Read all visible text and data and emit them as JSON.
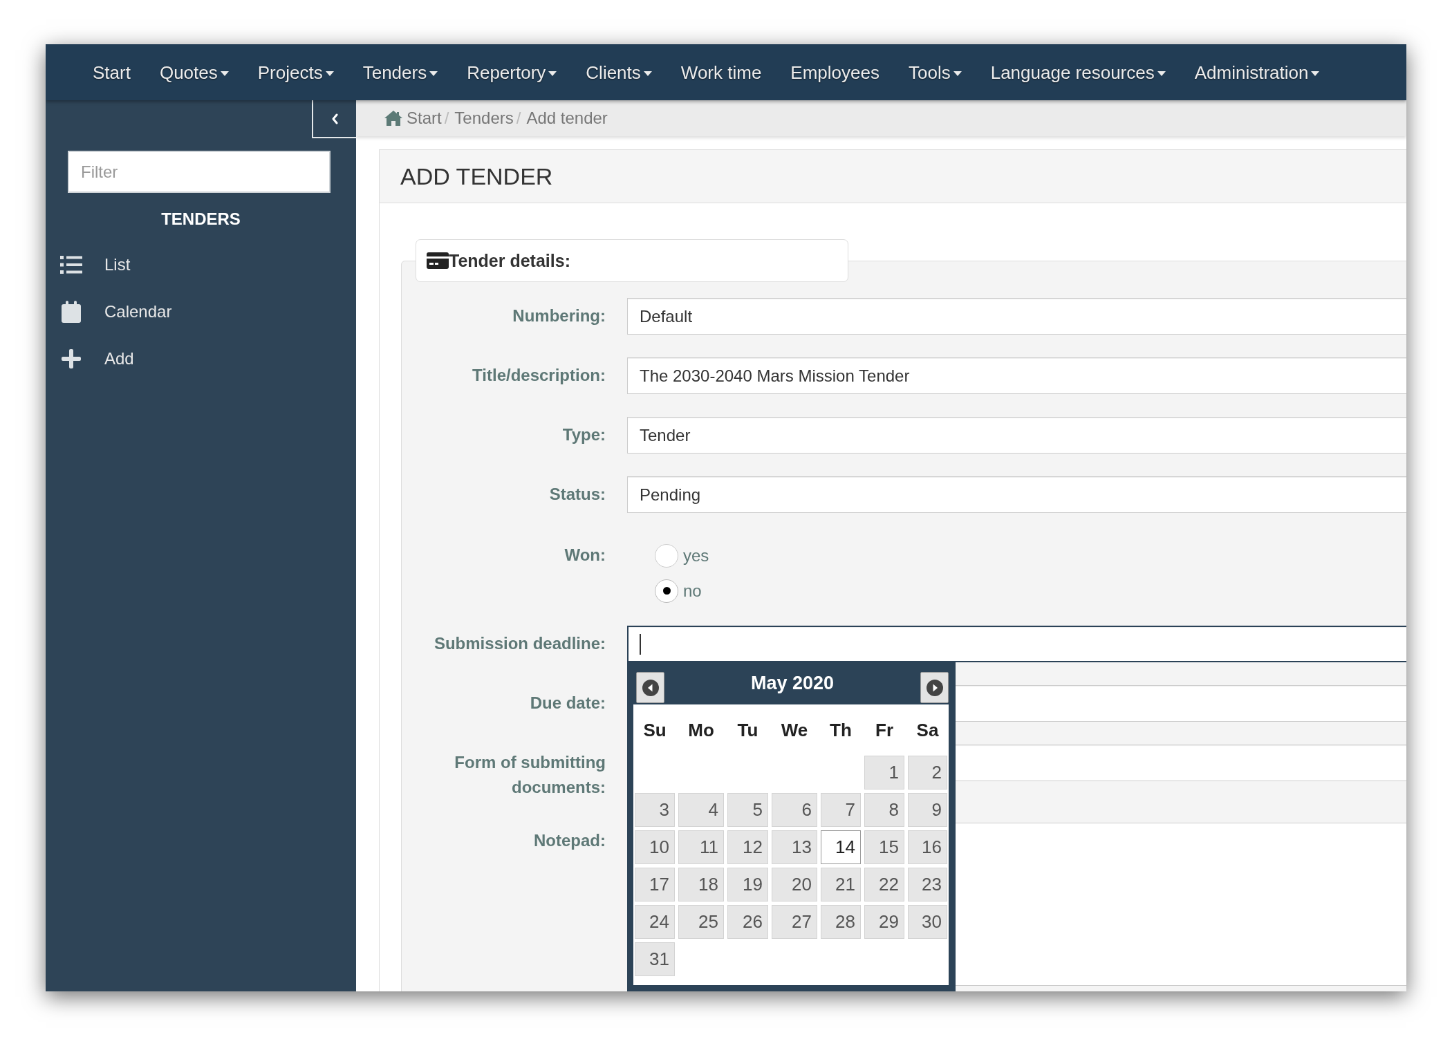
{
  "nav": [
    {
      "label": "Start",
      "dropdown": false
    },
    {
      "label": "Quotes",
      "dropdown": true
    },
    {
      "label": "Projects",
      "dropdown": true
    },
    {
      "label": "Tenders",
      "dropdown": true
    },
    {
      "label": "Repertory",
      "dropdown": true
    },
    {
      "label": "Clients",
      "dropdown": true
    },
    {
      "label": "Work time",
      "dropdown": false
    },
    {
      "label": "Employees",
      "dropdown": false
    },
    {
      "label": "Tools",
      "dropdown": true
    },
    {
      "label": "Language resources",
      "dropdown": true
    },
    {
      "label": "Administration",
      "dropdown": true
    }
  ],
  "sidebar": {
    "filter": {
      "placeholder": "Filter"
    },
    "heading": "TENDERS",
    "items": [
      {
        "label": "List"
      },
      {
        "label": "Calendar"
      },
      {
        "label": "Add"
      }
    ]
  },
  "breadcrumb": [
    {
      "label": "Start",
      "separator": "/"
    },
    {
      "label": "Tenders",
      "separator": "/"
    },
    {
      "label": "Add tender"
    }
  ],
  "panel": {
    "title": "ADD TENDER",
    "section": "Tender details:"
  },
  "form": {
    "fields": [
      {
        "label": "Numbering:",
        "kind": "input",
        "value": "Default",
        "focused": false
      },
      {
        "label": "Title/description:",
        "kind": "input",
        "value": "The 2030-2040 Mars Mission Tender",
        "focused": false
      },
      {
        "label": "Type:",
        "kind": "input",
        "value": "Tender",
        "focused": false
      },
      {
        "label": "Status:",
        "kind": "input",
        "value": "Pending",
        "focused": false
      },
      {
        "label": "Won:",
        "kind": "radio",
        "options": [
          {
            "label": "yes",
            "selected": false
          },
          {
            "label": "no",
            "selected": true
          }
        ]
      },
      {
        "label": "Submission deadline:",
        "kind": "input",
        "focused": true,
        "datepicker": {
          "month": "May 2020",
          "weekdays": [
            "Su",
            "Mo",
            "Tu",
            "We",
            "Th",
            "Fr",
            "Sa"
          ],
          "weeks": [
            [
              {
                "day": "1",
                "selected": false
              },
              {
                "day": "2",
                "selected": false
              }
            ],
            [
              {
                "day": "3",
                "selected": false
              },
              {
                "day": "4",
                "selected": false
              },
              {
                "day": "5",
                "selected": false
              },
              {
                "day": "6",
                "selected": false
              },
              {
                "day": "7",
                "selected": false
              },
              {
                "day": "8",
                "selected": false
              },
              {
                "day": "9",
                "selected": false
              }
            ],
            [
              {
                "day": "10",
                "selected": false
              },
              {
                "day": "11",
                "selected": false
              },
              {
                "day": "12",
                "selected": false
              },
              {
                "day": "13",
                "selected": false
              },
              {
                "day": "14",
                "selected": true
              },
              {
                "day": "15",
                "selected": false
              },
              {
                "day": "16",
                "selected": false
              }
            ],
            [
              {
                "day": "17",
                "selected": false
              },
              {
                "day": "18",
                "selected": false
              },
              {
                "day": "19",
                "selected": false
              },
              {
                "day": "20",
                "selected": false
              },
              {
                "day": "21",
                "selected": false
              },
              {
                "day": "22",
                "selected": false
              },
              {
                "day": "23",
                "selected": false
              }
            ],
            [
              {
                "day": "24",
                "selected": false
              },
              {
                "day": "25",
                "selected": false
              },
              {
                "day": "26",
                "selected": false
              },
              {
                "day": "27",
                "selected": false
              },
              {
                "day": "28",
                "selected": false
              },
              {
                "day": "29",
                "selected": false
              },
              {
                "day": "30",
                "selected": false
              }
            ],
            [
              {
                "day": "31",
                "selected": false
              }
            ]
          ]
        }
      },
      {
        "label": "Due date:",
        "kind": "input",
        "focused": false
      },
      {
        "label": "Form of submitting documents:",
        "kind": "input",
        "focused": false
      },
      {
        "label": "Notepad:",
        "kind": "textarea",
        "focused": false
      }
    ]
  }
}
